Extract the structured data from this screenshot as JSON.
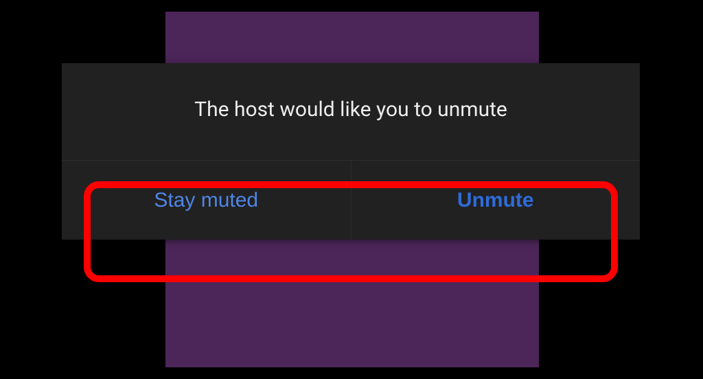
{
  "dialog": {
    "message": "The host would like you to unmute",
    "actions": {
      "stay_muted": "Stay muted",
      "unmute": "Unmute"
    }
  }
}
